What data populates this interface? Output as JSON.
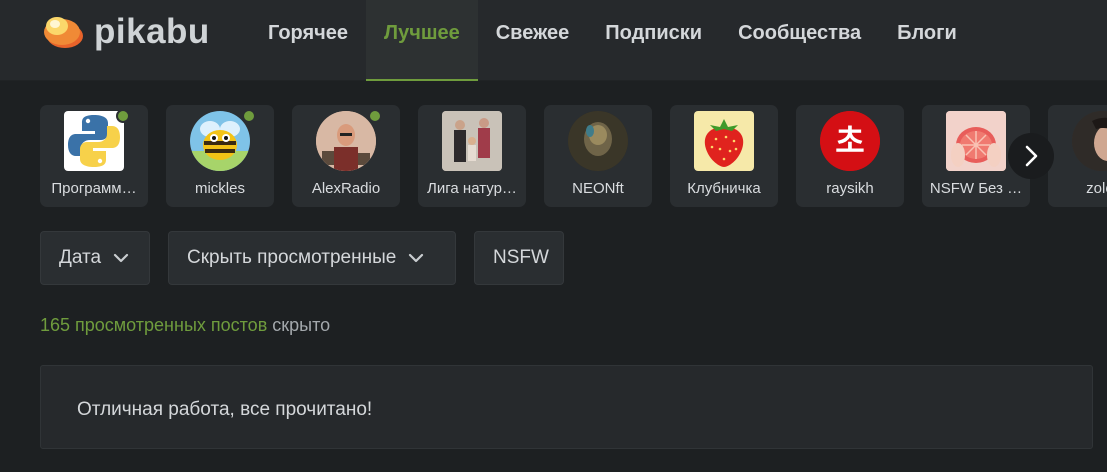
{
  "header": {
    "logo_text": "pikabu",
    "nav": [
      {
        "label": "Горячее",
        "active": false
      },
      {
        "label": "Лучшее",
        "active": true
      },
      {
        "label": "Свежее",
        "active": false
      },
      {
        "label": "Подписки",
        "active": false
      },
      {
        "label": "Сообщества",
        "active": false
      },
      {
        "label": "Блоги",
        "active": false
      }
    ]
  },
  "communities": [
    {
      "name": "Программ…",
      "online": true,
      "icon": "python-logo-icon"
    },
    {
      "name": "mickles",
      "online": true,
      "icon": "bee-avatar-icon"
    },
    {
      "name": "AlexRadio",
      "online": true,
      "icon": "man-photo-avatar-icon"
    },
    {
      "name": "Лига натур…",
      "online": false,
      "icon": "family-photo-avatar-icon"
    },
    {
      "name": "NEONft",
      "online": false,
      "icon": "dark-portrait-avatar-icon"
    },
    {
      "name": "Клубничка",
      "online": false,
      "icon": "strawberry-icon"
    },
    {
      "name": "raysikh",
      "online": false,
      "icon": "korean-char-badge-icon"
    },
    {
      "name": "NSFW Без …",
      "online": false,
      "icon": "grapefruit-avatar-icon"
    },
    {
      "name": "zolot",
      "online": false,
      "icon": "portrait-avatar-icon"
    }
  ],
  "filters": {
    "date": "Дата",
    "hide_viewed": "Скрыть просмотренные",
    "nsfw": "NSFW"
  },
  "hidden_info": {
    "link": "165 просмотренных постов",
    "rest": " скрыто"
  },
  "done_message": "Отличная работа, все прочитано!",
  "colors": {
    "accent": "#6f9c3d",
    "background": "#1d2022",
    "panel": "#2a2e31"
  }
}
